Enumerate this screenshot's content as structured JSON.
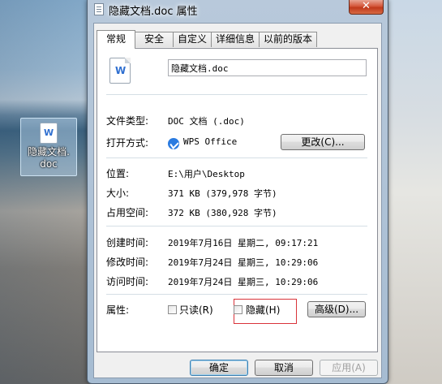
{
  "desktop": {
    "icon_label_line1": "隐藏文档.",
    "icon_label_line2": "doc",
    "icon_glyph": "W"
  },
  "window": {
    "title": "隐藏文档.doc 属性",
    "close_glyph": "✕"
  },
  "tabs": [
    {
      "label": "常规",
      "active": true
    },
    {
      "label": "安全",
      "active": false
    },
    {
      "label": "自定义",
      "active": false
    },
    {
      "label": "详细信息",
      "active": false
    },
    {
      "label": "以前的版本",
      "active": false
    }
  ],
  "general": {
    "file_glyph": "W",
    "file_name": "隐藏文档.doc",
    "file_type_label": "文件类型:",
    "file_type_value": "DOC 文档 (.doc)",
    "opens_with_label": "打开方式:",
    "opens_with_value": "WPS Office",
    "change_button": "更改(C)...",
    "location_label": "位置:",
    "location_value": "E:\\用户\\Desktop",
    "size_label": "大小:",
    "size_value": "371 KB (379,978 字节)",
    "size_on_disk_label": "占用空间:",
    "size_on_disk_value": "372 KB (380,928 字节)",
    "created_label": "创建时间:",
    "created_value": "2019年7月16日 星期二, 09:17:21",
    "modified_label": "修改时间:",
    "modified_value": "2019年7月24日 星期三, 10:29:06",
    "accessed_label": "访问时间:",
    "accessed_value": "2019年7月24日 星期三, 10:29:06",
    "attributes_label": "属性:",
    "readonly_label": "只读(R)",
    "readonly_checked": false,
    "hidden_label": "隐藏(H)",
    "hidden_checked": false,
    "advanced_button": "高级(D)..."
  },
  "footer": {
    "ok": "确定",
    "cancel": "取消",
    "apply": "应用(A)"
  },
  "colors": {
    "highlight_box": "#d9333a",
    "wps_blue": "#2b7be0"
  }
}
